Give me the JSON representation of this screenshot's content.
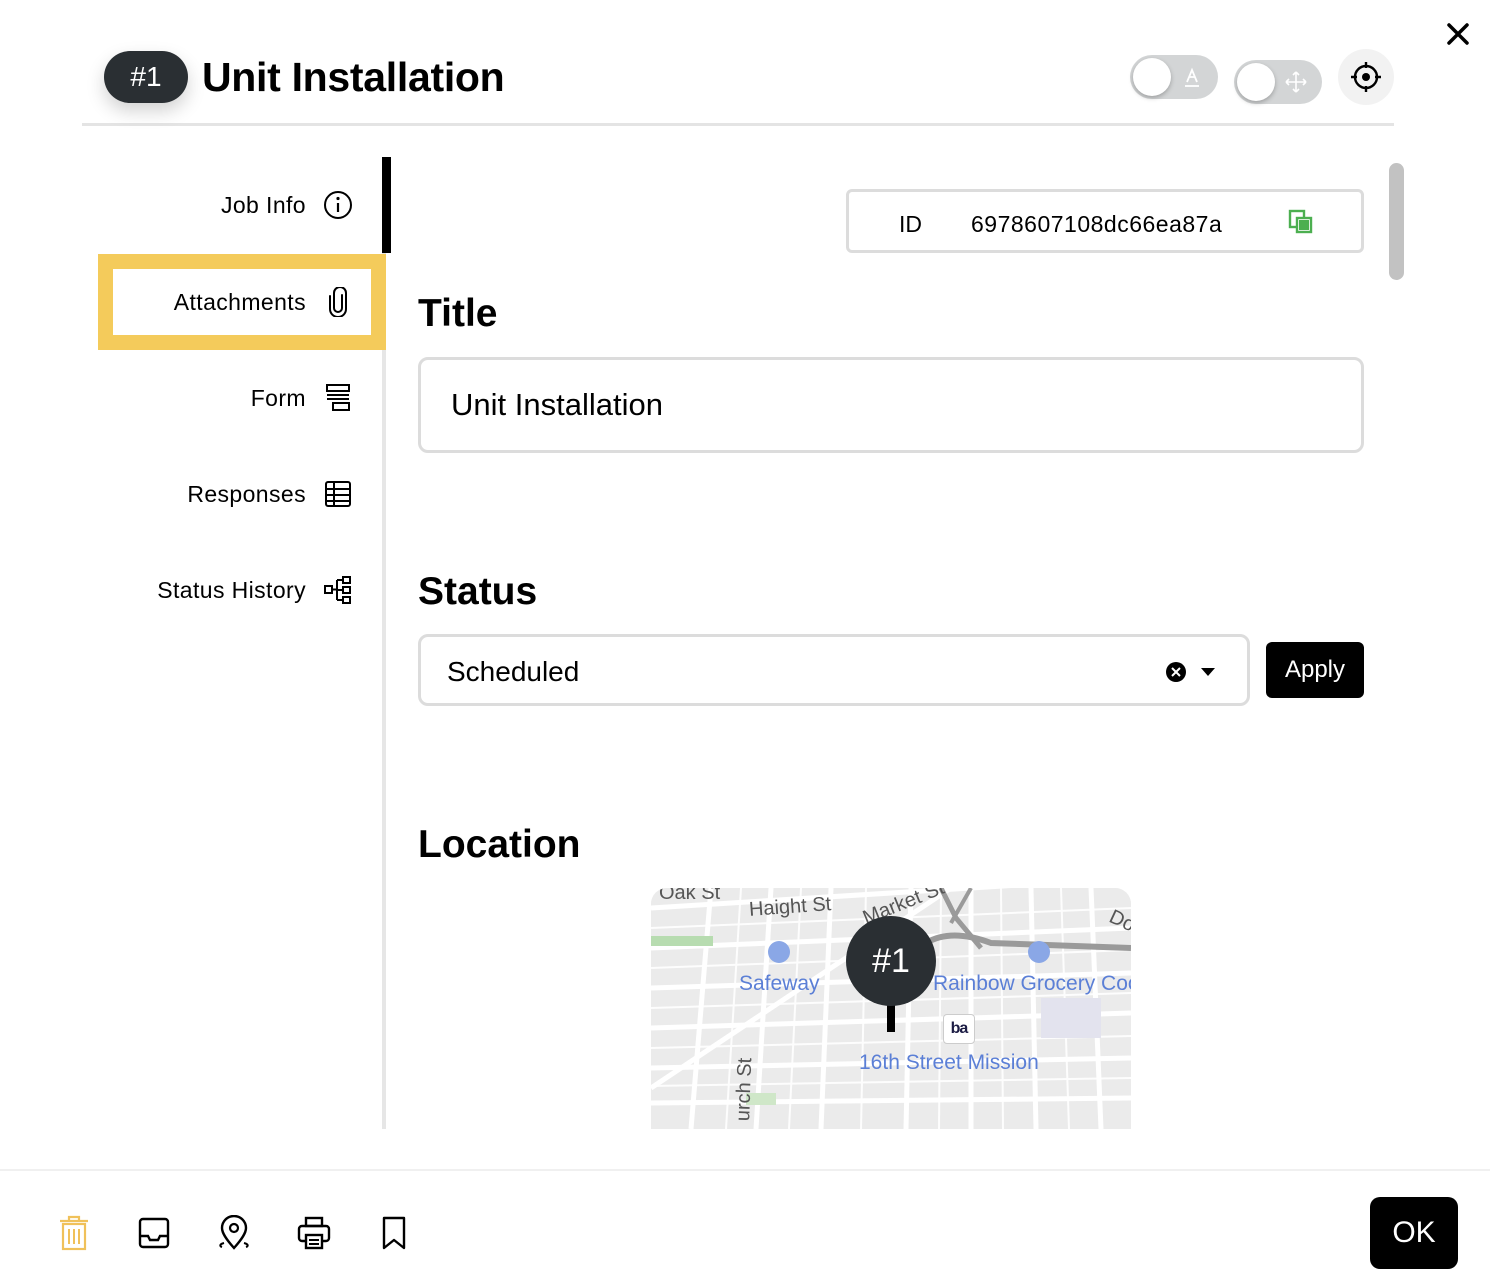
{
  "header": {
    "job_number": "#1",
    "title": "Unit Installation"
  },
  "sidebar": {
    "items": [
      {
        "label": "Job Info",
        "icon": "info-icon",
        "active": true
      },
      {
        "label": "Attachments",
        "icon": "paperclip-icon",
        "highlighted": true
      },
      {
        "label": "Form",
        "icon": "form-icon"
      },
      {
        "label": "Responses",
        "icon": "table-icon"
      },
      {
        "label": "Status History",
        "icon": "hierarchy-icon"
      }
    ]
  },
  "job_id": {
    "label": "ID",
    "value": "6978607108dc66ea87a"
  },
  "title_section": {
    "heading": "Title",
    "value": "Unit Installation"
  },
  "status_section": {
    "heading": "Status",
    "selected": "Scheduled",
    "apply_label": "Apply"
  },
  "location_section": {
    "heading": "Location",
    "map": {
      "marker_label": "#1",
      "labels": [
        "Oak St",
        "Haight St",
        "Market St",
        "Do",
        "urch St"
      ],
      "pois": [
        "Safeway",
        "Rainbow Grocery Coo",
        "16th Street Mission"
      ],
      "transit_logo": "ba"
    }
  },
  "footer": {
    "ok_label": "OK"
  },
  "colors": {
    "highlight": "#f4cb5b",
    "badge": "#2a2f33",
    "copy_icon": "#4caf50",
    "delete_icon": "#f0c15a",
    "poi": "#5b7fd6"
  }
}
